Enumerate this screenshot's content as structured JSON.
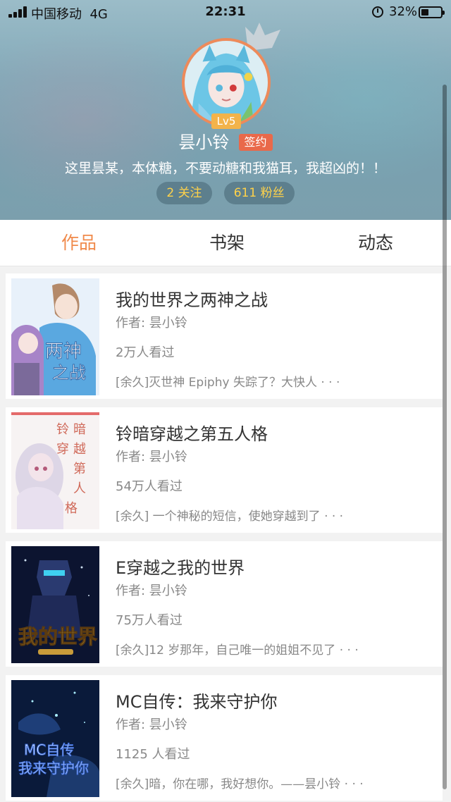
{
  "status_bar": {
    "carrier": "中国移动",
    "network": "4G",
    "time": "22:31",
    "battery": "32%",
    "icons": [
      "signal-icon",
      "alarm-icon",
      "battery-icon"
    ]
  },
  "profile": {
    "level": "Lv5",
    "username": "昙小铃",
    "signed_badge": "签约",
    "bio": "这里昙某，本体糖，不要动糖和我猫耳，我超凶的！！",
    "following": "2 关注",
    "followers": "611 粉丝"
  },
  "tabs": [
    {
      "label": "作品",
      "active": true
    },
    {
      "label": "书架",
      "active": false
    },
    {
      "label": "动态",
      "active": false
    }
  ],
  "books": [
    {
      "title": "我的世界之两神之战",
      "author": "作者: 昙小铃",
      "views": "2万人看过",
      "desc": "[余久]灭世神 Epiphy 失踪了？大快人 · · ·",
      "cover_text": "两神之战"
    },
    {
      "title": "铃暗穿越之第五人格",
      "author": "作者: 昙小铃",
      "views": "54万人看过",
      "desc": "[余久] 一个神秘的短信，使她穿越到了 · · ·",
      "cover_text": "铃暗穿越之第五人格"
    },
    {
      "title": "E穿越之我的世界",
      "author": "作者: 昙小铃",
      "views": "75万人看过",
      "desc": "[余久]12 岁那年，自己唯一的姐姐不见了 · · ·",
      "cover_text": "我的世界"
    },
    {
      "title": "MC自传：我来守护你",
      "author": "作者: 昙小铃",
      "views": "1125 人看过",
      "desc": "[余久]暗，你在哪，我好想你。——昙小铃 · · ·",
      "cover_text": "MC自传 我来守护你"
    }
  ],
  "colors": {
    "accent": "#f08a4b",
    "signed": "#e9694a",
    "level": "#f3b34a",
    "stat_text": "#ffd24a"
  }
}
